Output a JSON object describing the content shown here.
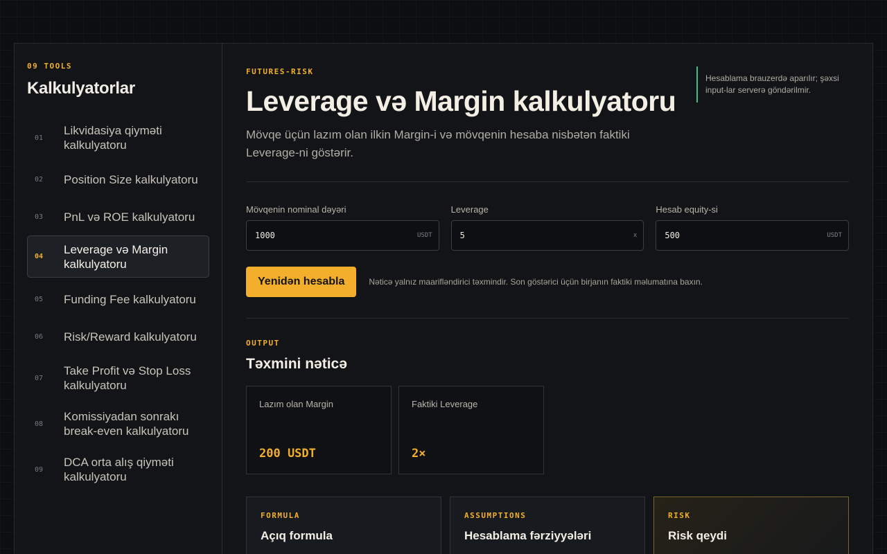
{
  "sidebar": {
    "kicker": "09 TOOLS",
    "title": "Kalkulyatorlar",
    "items": [
      {
        "num": "01",
        "label": "Likvidasiya qiyməti kalkulyatoru"
      },
      {
        "num": "02",
        "label": "Position Size kalkulyatoru"
      },
      {
        "num": "03",
        "label": "PnL və ROE kalkulyatoru"
      },
      {
        "num": "04",
        "label": "Leverage və Margin kalkulyatoru"
      },
      {
        "num": "05",
        "label": "Funding Fee kalkulyatoru"
      },
      {
        "num": "06",
        "label": "Risk/Reward kalkulyatoru"
      },
      {
        "num": "07",
        "label": "Take Profit və Stop Loss kalkulyatoru"
      },
      {
        "num": "08",
        "label": "Komissiyadan sonrakı break-even kalkulyatoru"
      },
      {
        "num": "09",
        "label": "DCA orta alış qiyməti kalkulyatoru"
      }
    ]
  },
  "header": {
    "kicker": "FUTURES-RISK",
    "title": "Leverage və Margin kalkulyatoru",
    "subtitle": "Mövqe üçün lazım olan ilkin Margin-i və mövqenin hesaba nisbətən faktiki Leverage-ni göstərir.",
    "notice": "Hesablama brauzerdə aparılır; şəxsi input-lar serverə göndərilmir."
  },
  "form": {
    "fields": [
      {
        "label": "Mövqenin nominal dəyəri",
        "value": "1000",
        "unit": "USDT"
      },
      {
        "label": "Leverage",
        "value": "5",
        "unit": "x"
      },
      {
        "label": "Hesab equity-si",
        "value": "500",
        "unit": "USDT"
      }
    ],
    "button_label": "Yenidən hesabla",
    "disclaimer": "Nəticə yalnız maarifləndirici təxmindir. Son göstərici üçün birjanın faktiki məlumatına baxın."
  },
  "output": {
    "kicker": "OUTPUT",
    "title": "Təxmini nəticə",
    "cards": [
      {
        "label": "Lazım olan Margin",
        "value": "200 USDT"
      },
      {
        "label": "Faktiki Leverage",
        "value": "2×"
      }
    ]
  },
  "panels": [
    {
      "kicker": "FORMULA",
      "title": "Açıq formula"
    },
    {
      "kicker": "ASSUMPTIONS",
      "title": "Hesablama fərziyyələri"
    },
    {
      "kicker": "RISK",
      "title": "Risk qeydi"
    }
  ],
  "colors": {
    "accent": "#f3af2c",
    "notice_border": "#3fbf83",
    "background": "#0d0e11"
  }
}
